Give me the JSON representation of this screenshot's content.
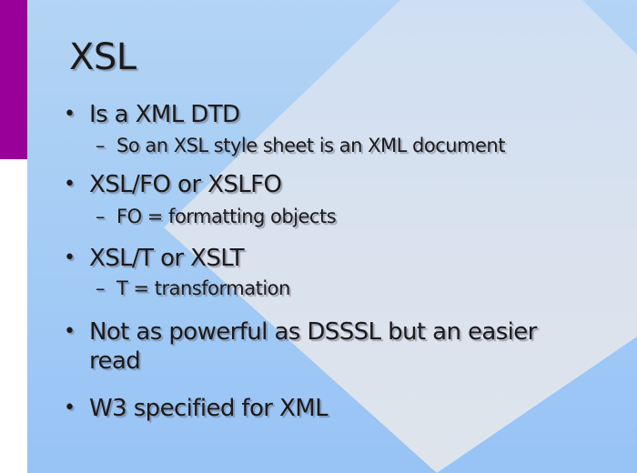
{
  "slide": {
    "title": "XSL",
    "accent_color": "#990099",
    "background_color": "#a6cdf5",
    "bullets": [
      {
        "text": "Is a XML DTD",
        "sub": "So an XSL style sheet is an XML document"
      },
      {
        "text": "XSL/FO or XSLFO",
        "sub": "FO = formatting objects"
      },
      {
        "text": "XSL/T or XSLT",
        "sub": "T = transformation"
      },
      {
        "text": "Not as powerful as DSSSL but an easier read"
      },
      {
        "text": "W3 specified for XML"
      }
    ],
    "bullet_glyph": "•",
    "sub_glyph": "–"
  }
}
